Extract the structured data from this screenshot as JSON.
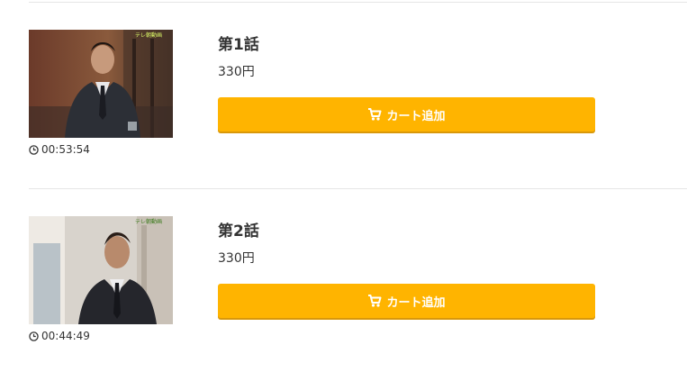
{
  "episodes": [
    {
      "title": "第1話",
      "price": "330円",
      "cart_label": "カート追加",
      "duration": "00:53:54"
    },
    {
      "title": "第2話",
      "price": "330円",
      "cart_label": "カート追加",
      "duration": "00:44:49"
    }
  ],
  "colors": {
    "cart_button": "#ffb400",
    "text": "#333333",
    "divider": "#e6e6e6"
  }
}
